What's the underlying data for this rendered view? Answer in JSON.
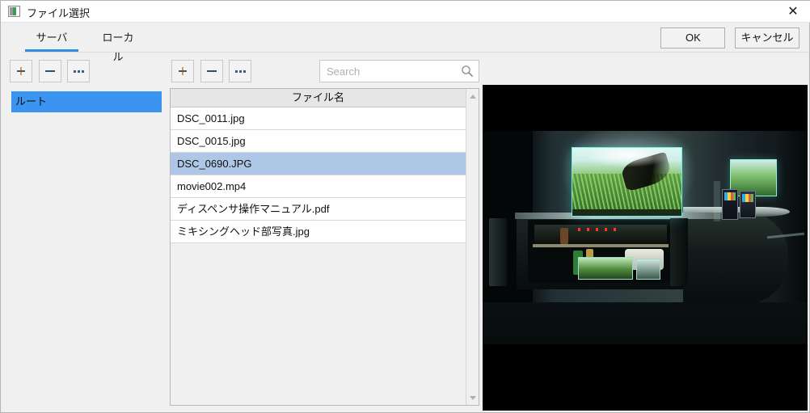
{
  "window": {
    "title": "ファイル選択",
    "icon": "image-file-icon",
    "close_label": "✕"
  },
  "tabs": [
    {
      "label": "サーバ",
      "active": true
    },
    {
      "label": "ローカル",
      "active": false
    }
  ],
  "dialog_buttons": {
    "ok_label": "OK",
    "cancel_label": "キャンセル"
  },
  "tree_toolbar": {
    "add_label": "+",
    "remove_label": "−",
    "more_label": "...",
    "add_icon": "plus-icon",
    "remove_icon": "minus-icon",
    "more_icon": "ellipsis-icon"
  },
  "list_toolbar": {
    "add_label": "+",
    "remove_label": "−",
    "more_label": "...",
    "add_icon": "plus-icon",
    "remove_icon": "minus-icon",
    "more_icon": "ellipsis-icon"
  },
  "search": {
    "placeholder": "Search",
    "value": "",
    "icon": "search-icon"
  },
  "tree": {
    "items": [
      {
        "label": "ルート",
        "selected": true
      }
    ]
  },
  "file_list": {
    "column_header": "ファイル名",
    "rows": [
      {
        "name": "DSC_0011.jpg",
        "selected": false
      },
      {
        "name": "DSC_0015.jpg",
        "selected": false
      },
      {
        "name": "DSC_0690.JPG",
        "selected": true
      },
      {
        "name": "movie002.mp4",
        "selected": false
      },
      {
        "name": "ディスペンサ操作マニュアル.pdf",
        "selected": false
      },
      {
        "name": "ミキシングヘッド部写真.jpg",
        "selected": false
      }
    ],
    "scrollbar": {
      "up_icon": "scroll-up-arrow-icon",
      "down_icon": "scroll-down-arrow-icon"
    }
  },
  "preview": {
    "alt": "暗い室内の水槽とキャビネットの写真",
    "letterbox": true
  },
  "colors": {
    "accent": "#2f8fe0",
    "tree_selection": "#3b95f0",
    "row_selection": "#aec7e6",
    "window_bg": "#f0f0f0",
    "panel_bg": "#ffffff",
    "preview_bg": "#000000"
  }
}
